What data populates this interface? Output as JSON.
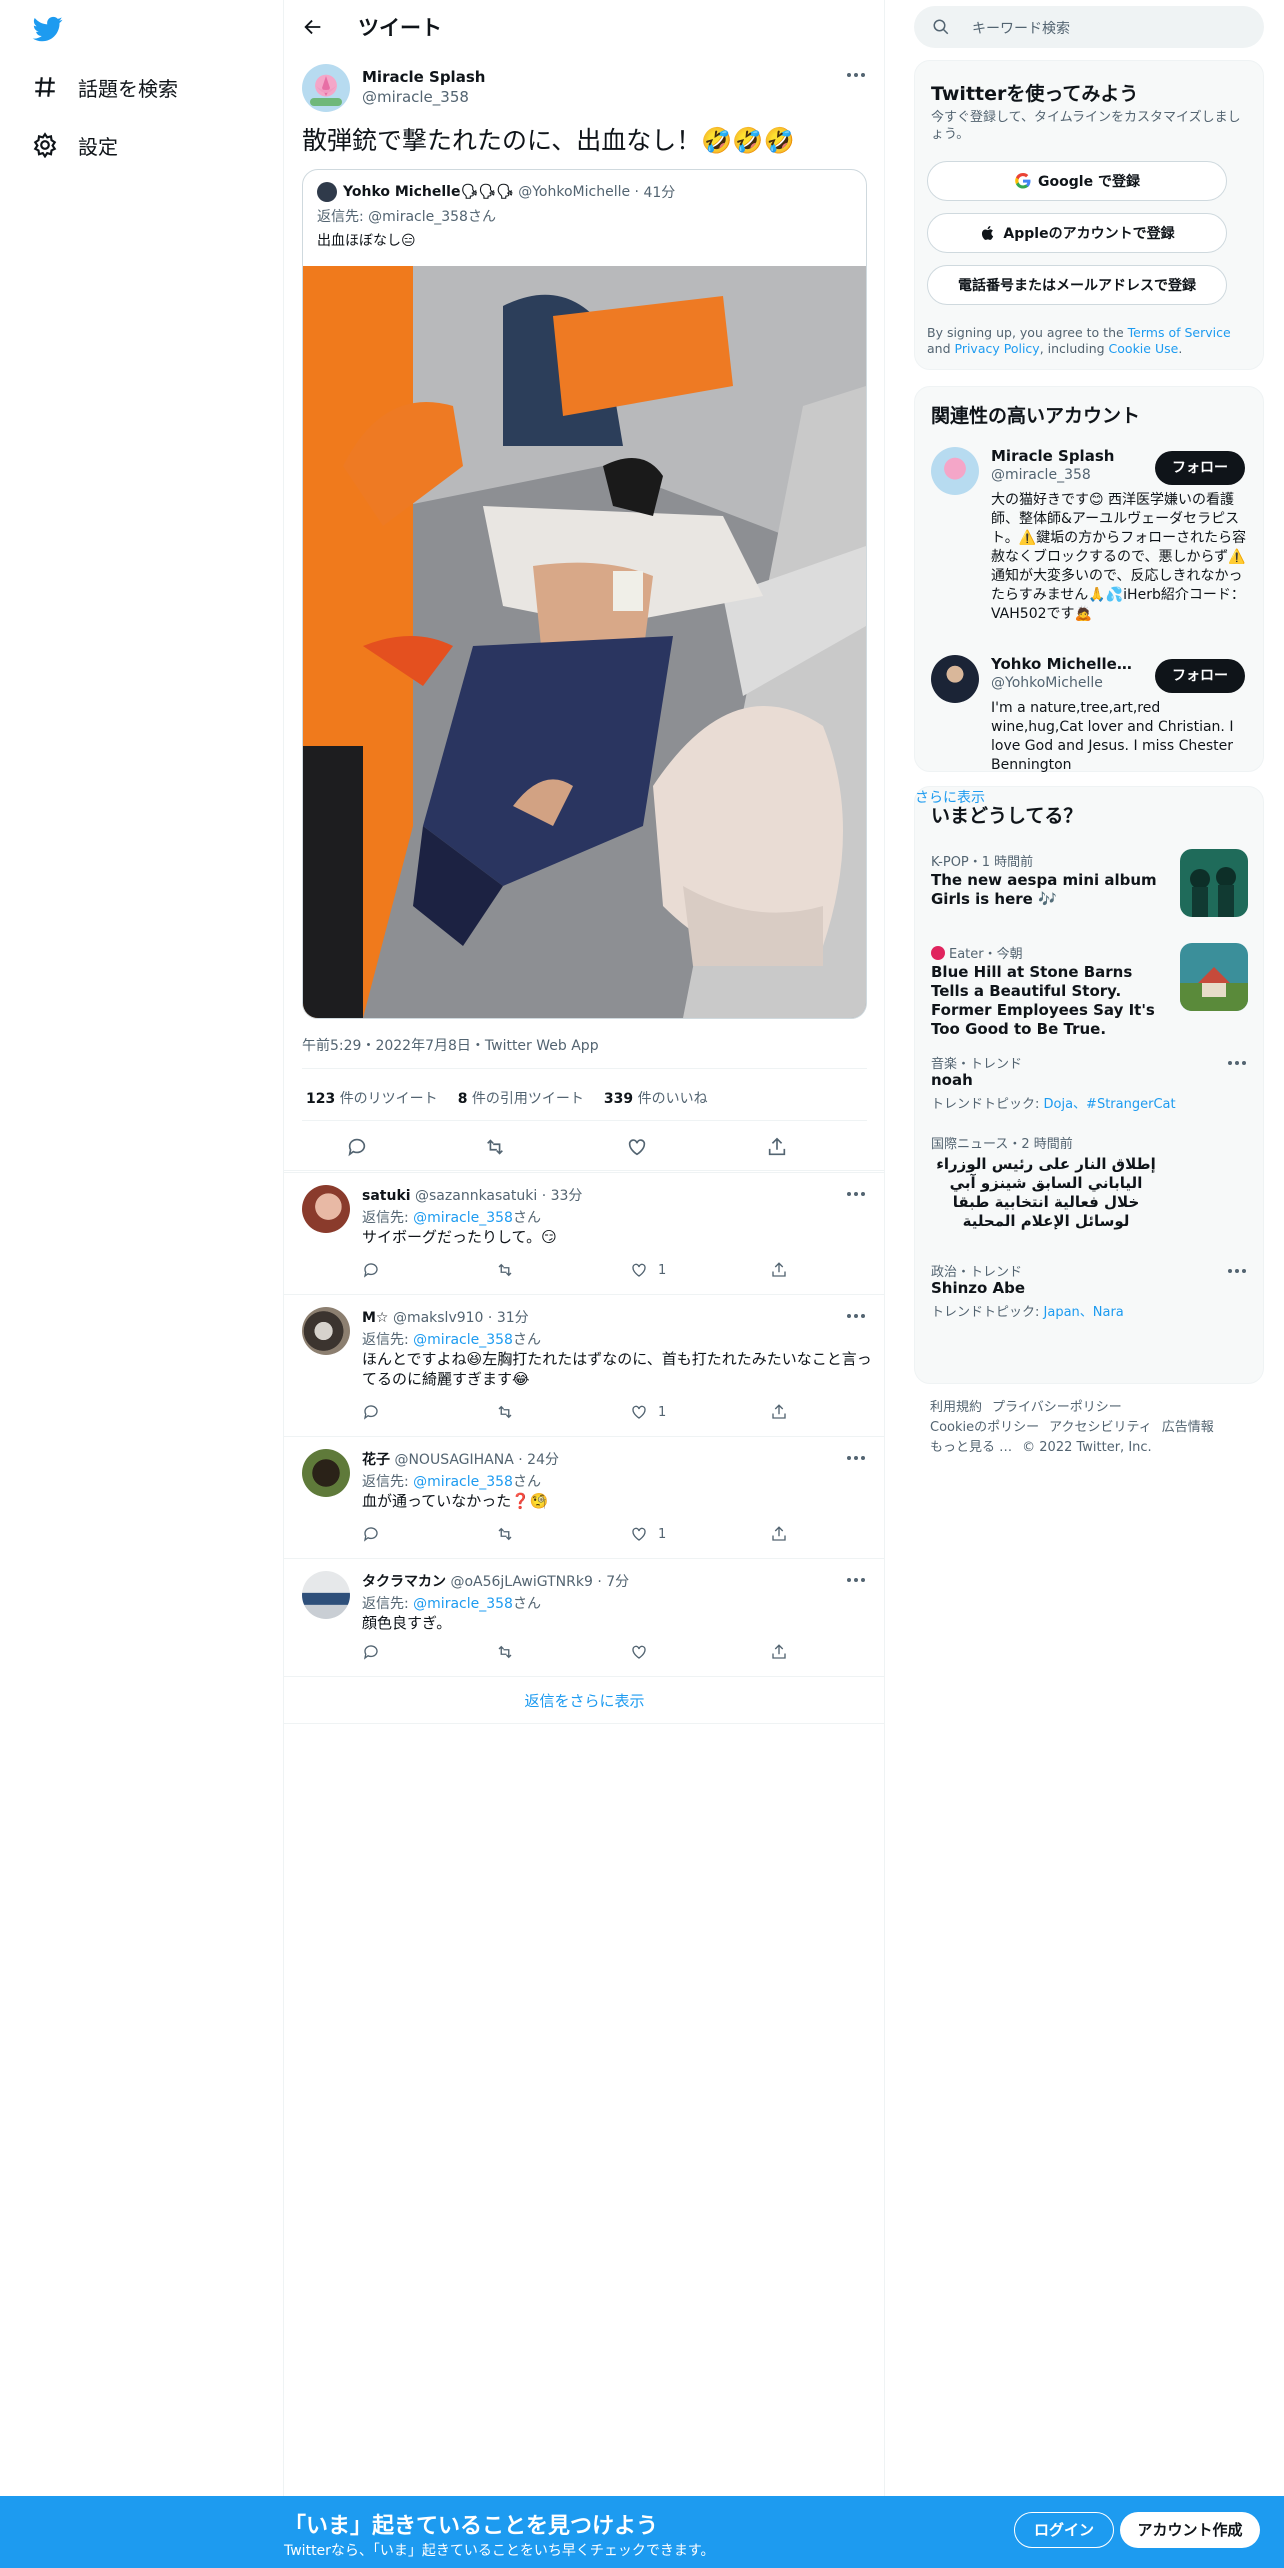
{
  "nav": {
    "logo": "twitter-bird-icon",
    "items": [
      {
        "label": "話題を検索",
        "icon": "hashtag-icon"
      },
      {
        "label": "設定",
        "icon": "gear-icon"
      }
    ]
  },
  "header": {
    "title": "ツイート",
    "back_icon": "back-arrow-icon"
  },
  "tweet": {
    "author_name": "Miracle Splash",
    "author_handle": "@miracle_358",
    "text": "散弾銃で撃たれたのに、出血なし！🤣🤣🤣",
    "quote": {
      "name": "Yohko Michelle🗣🗣🗣",
      "handle": "@YohkoMichelle",
      "time": "41分",
      "reply_to": "返信先: @miracle_358さん",
      "text": "出血ほぼなし😑"
    },
    "meta": "午前5:29・2022年7月8日・Twitter Web App",
    "stats": {
      "retweets_num": "123",
      "retweets_label": "件のリツイート",
      "quotes_num": "8",
      "quotes_label": "件の引用ツイート",
      "likes_num": "339",
      "likes_label": "件のいいね"
    }
  },
  "replies": [
    {
      "name": "satuki",
      "handle": "@sazannkasatuki",
      "time": "33分",
      "reply_prefix": "返信先: ",
      "reply_handle": "@miracle_358",
      "reply_suffix": "さん",
      "text": "サイボーグだったりして。😏",
      "likes": "1"
    },
    {
      "name": "M☆",
      "handle": "@makslv910",
      "time": "31分",
      "reply_prefix": "返信先: ",
      "reply_handle": "@miracle_358",
      "reply_suffix": "さん",
      "text": "ほんとですよね😆左胸打たれたはずなのに、首も打たれたみたいなこと言ってるのに綺麗すぎます😂",
      "likes": "1"
    },
    {
      "name": "花子",
      "handle": "@NOUSAGIHANA",
      "time": "24分",
      "reply_prefix": "返信先: ",
      "reply_handle": "@miracle_358",
      "reply_suffix": "さん",
      "text": "血が通っていなかった❓🧐",
      "likes": "1"
    },
    {
      "name": "タクラマカン",
      "handle": "@oA56jLAwiGTNRk9",
      "time": "7分",
      "reply_prefix": "返信先: ",
      "reply_handle": "@miracle_358",
      "reply_suffix": "さん",
      "text": "顔色良すぎ。",
      "likes": ""
    }
  ],
  "show_more_replies": "返信をさらに表示",
  "search": {
    "placeholder": "キーワード検索"
  },
  "signup": {
    "title": "Twitterを使ってみよう",
    "subtitle": "今すぐ登録して、タイムラインをカスタマイズしましょう。",
    "google": "Google で登録",
    "apple": "Appleのアカウントで登録",
    "phone": "電話番号またはメールアドレスで登録",
    "terms_a": "By signing up, you agree to the ",
    "terms_link1": "Terms of Service",
    "terms_b": " and ",
    "terms_link2": "Privacy Policy",
    "terms_c": ", including ",
    "terms_link3": "Cookie Use",
    "terms_d": "."
  },
  "related": {
    "title": "関連性の高いアカウント",
    "follow_label": "フォロー",
    "accounts": [
      {
        "name": "Miracle Splash",
        "handle": "@miracle_358",
        "bio": "大の猫好きです😊 西洋医学嫌いの看護師、整体師&アーユルヴェーダセラピスト。⚠️鍵垢の方からフォローされたら容赦なくブロックするので、悪しからず⚠️ 通知が大変多いので、反応しきれなかったらすみません🙏💦iHerb紹介コード：VAH502です🙇"
      },
      {
        "name": "Yohko Michelle🗣🗣🗣",
        "handle": "@YohkoMichelle",
        "bio": "I'm a nature,tree,art,red wine,hug,Cat lover and Christian. I love God and Jesus. I miss Chester Bennington"
      }
    ]
  },
  "trends": {
    "title": "いまどうしてる？",
    "items": [
      {
        "category": "K-POP・1 時間前",
        "title": "The new aespa mini album Girls is here 🎶"
      },
      {
        "category": "Eater・今朝",
        "title": "Blue Hill at Stone Barns Tells a Beautiful Story. Former Employees Say It's Too Good to Be True."
      },
      {
        "category": "音楽・トレンド",
        "title": "noah",
        "sub_prefix": "トレンドトピック: ",
        "sub_links": "Doja、#StrangerCat"
      },
      {
        "category": "国際ニュース・2 時間前",
        "title": "إطلاق النار على رئيس الوزراء الياباني السابق شينزو آبي خلال فعالية انتخابية طبقا لوسائل الإعلام المحلية"
      },
      {
        "category": "政治・トレンド",
        "title": "Shinzo Abe",
        "sub_prefix": "トレンドトピック: ",
        "sub_links": "Japan、Nara"
      }
    ],
    "show_more": "さらに表示"
  },
  "footer": {
    "line1": [
      "利用規約",
      "プライバシーポリシー"
    ],
    "line2": [
      "Cookieのポリシー",
      "アクセシビリティ",
      "広告情報"
    ],
    "line3": [
      "もっと見る …",
      "© 2022 Twitter, Inc."
    ]
  },
  "banner": {
    "title": "「いま」起きていることを見つけよう",
    "subtitle": "Twitterなら、「いま」起きていることをいち早くチェックできます。",
    "login": "ログイン",
    "signup": "アカウント作成"
  }
}
